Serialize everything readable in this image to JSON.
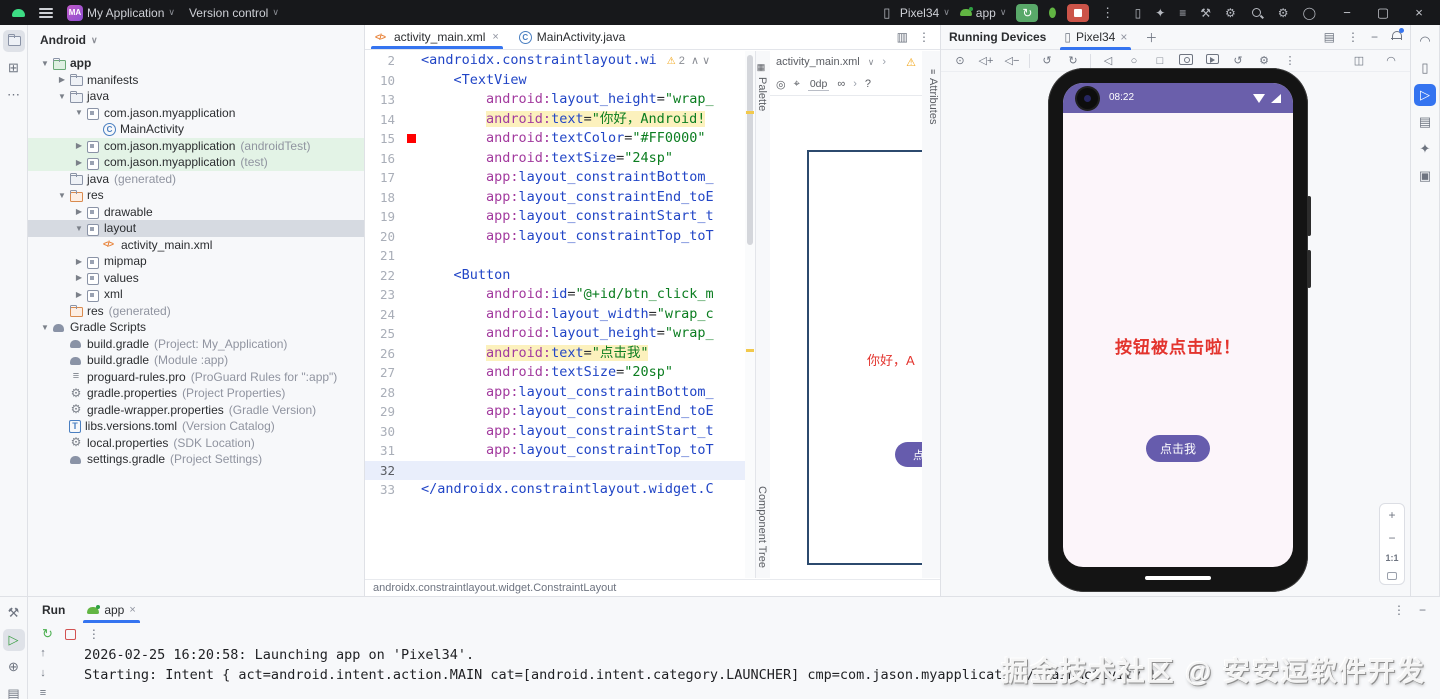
{
  "titlebar": {
    "project_badge": "MA",
    "project": "My Application",
    "version_control": "Version control",
    "device_selector": "Pixel34",
    "run_config": "app",
    "action_icons": [
      "device-manager",
      "ai-assistant",
      "commit",
      "build",
      "sdk-manager",
      "search",
      "settings",
      "account"
    ],
    "window_icons": [
      "minimize",
      "maximize",
      "close"
    ]
  },
  "left_strip": {
    "top": [
      "project",
      "structure",
      "more"
    ],
    "bottom": [
      "build",
      "run",
      "profiler",
      "logcat"
    ]
  },
  "project_panel": {
    "view": "Android",
    "tree": [
      {
        "label": "app",
        "depth": 0,
        "icon": "app",
        "arrow": "v",
        "bold": true
      },
      {
        "label": "manifests",
        "depth": 1,
        "icon": "folder",
        "arrow": ">"
      },
      {
        "label": "java",
        "depth": 1,
        "icon": "folder",
        "arrow": "v"
      },
      {
        "label": "com.jason.myapplication",
        "depth": 2,
        "icon": "pkg",
        "arrow": "v"
      },
      {
        "label": "MainActivity",
        "depth": 3,
        "icon": "class"
      },
      {
        "label": "com.jason.myapplication",
        "detail": "(androidTest)",
        "depth": 2,
        "icon": "pkg",
        "arrow": ">",
        "highlight": "green"
      },
      {
        "label": "com.jason.myapplication",
        "detail": "(test)",
        "depth": 2,
        "icon": "pkg",
        "arrow": ">",
        "highlight": "green"
      },
      {
        "label": "java",
        "detail": "(generated)",
        "depth": 1,
        "icon": "folder"
      },
      {
        "label": "res",
        "depth": 1,
        "icon": "res",
        "arrow": "v"
      },
      {
        "label": "drawable",
        "depth": 2,
        "icon": "pkg",
        "arrow": ">"
      },
      {
        "label": "layout",
        "depth": 2,
        "icon": "pkg",
        "arrow": "v",
        "highlight": "selected"
      },
      {
        "label": "activity_main.xml",
        "depth": 3,
        "icon": "xml"
      },
      {
        "label": "mipmap",
        "depth": 2,
        "icon": "pkg",
        "arrow": ">"
      },
      {
        "label": "values",
        "depth": 2,
        "icon": "pkg",
        "arrow": ">"
      },
      {
        "label": "xml",
        "depth": 2,
        "icon": "pkg",
        "arrow": ">"
      },
      {
        "label": "res",
        "detail": "(generated)",
        "depth": 1,
        "icon": "res"
      },
      {
        "label": "Gradle Scripts",
        "depth": 0,
        "icon": "gradle",
        "arrow": "v"
      },
      {
        "label": "build.gradle",
        "detail": "(Project: My_Application)",
        "depth": 1,
        "icon": "gradle"
      },
      {
        "label": "build.gradle",
        "detail": "(Module :app)",
        "depth": 1,
        "icon": "gradle"
      },
      {
        "label": "proguard-rules.pro",
        "detail": "(ProGuard Rules for \":app\")",
        "depth": 1,
        "icon": "list"
      },
      {
        "label": "gradle.properties",
        "detail": "(Project Properties)",
        "depth": 1,
        "icon": "gear"
      },
      {
        "label": "gradle-wrapper.properties",
        "detail": "(Gradle Version)",
        "depth": 1,
        "icon": "gear"
      },
      {
        "label": "libs.versions.toml",
        "detail": "(Version Catalog)",
        "depth": 1,
        "icon": "toml"
      },
      {
        "label": "local.properties",
        "detail": "(SDK Location)",
        "depth": 1,
        "icon": "gear"
      },
      {
        "label": "settings.gradle",
        "detail": "(Project Settings)",
        "depth": 1,
        "icon": "gradle"
      }
    ]
  },
  "editor": {
    "tabs": [
      {
        "label": "activity_main.xml",
        "icon": "xml",
        "active": true,
        "closable": true
      },
      {
        "label": "MainActivity.java",
        "icon": "class",
        "active": false
      }
    ],
    "warning_badge": "2",
    "breadcrumb": "androidx.constraintlayout.widget.ConstraintLayout",
    "lines": [
      {
        "n": "2",
        "ind": 0,
        "seg": [
          [
            "tag",
            "<androidx.constraintlayout.wi"
          ]
        ],
        "warn": true
      },
      {
        "n": "10",
        "ind": 1,
        "seg": [
          [
            "tag",
            "<TextView"
          ]
        ]
      },
      {
        "n": "13",
        "ind": 2,
        "seg": [
          [
            "ns",
            "android:"
          ],
          [
            "attr",
            "layout_height"
          ],
          [
            "pl",
            "="
          ],
          [
            "val",
            "\"wrap_"
          ]
        ]
      },
      {
        "n": "14",
        "ind": 2,
        "hl": true,
        "seg": [
          [
            "ns",
            "android:"
          ],
          [
            "attr",
            "text"
          ],
          [
            "pl",
            "="
          ],
          [
            "val",
            "\"你好，Android!"
          ]
        ]
      },
      {
        "n": "15",
        "ind": 2,
        "swatch": true,
        "seg": [
          [
            "ns",
            "android:"
          ],
          [
            "attr",
            "textColor"
          ],
          [
            "pl",
            "="
          ],
          [
            "val",
            "\"#FF0000\""
          ]
        ]
      },
      {
        "n": "16",
        "ind": 2,
        "seg": [
          [
            "ns",
            "android:"
          ],
          [
            "attr",
            "textSize"
          ],
          [
            "pl",
            "="
          ],
          [
            "val",
            "\"24sp\""
          ]
        ]
      },
      {
        "n": "17",
        "ind": 2,
        "seg": [
          [
            "ns",
            "app:"
          ],
          [
            "attr",
            "layout_constraintBottom_"
          ]
        ]
      },
      {
        "n": "18",
        "ind": 2,
        "seg": [
          [
            "ns",
            "app:"
          ],
          [
            "attr",
            "layout_constraintEnd_toE"
          ]
        ]
      },
      {
        "n": "19",
        "ind": 2,
        "seg": [
          [
            "ns",
            "app:"
          ],
          [
            "attr",
            "layout_constraintStart_t"
          ]
        ]
      },
      {
        "n": "20",
        "ind": 2,
        "seg": [
          [
            "ns",
            "app:"
          ],
          [
            "attr",
            "layout_constraintTop_toT"
          ]
        ]
      },
      {
        "n": "21",
        "ind": 0,
        "seg": []
      },
      {
        "n": "22",
        "ind": 1,
        "seg": [
          [
            "tag",
            "<Button"
          ]
        ]
      },
      {
        "n": "23",
        "ind": 2,
        "seg": [
          [
            "ns",
            "android:"
          ],
          [
            "attr",
            "id"
          ],
          [
            "pl",
            "="
          ],
          [
            "val",
            "\"@+id/btn_click_m"
          ]
        ]
      },
      {
        "n": "24",
        "ind": 2,
        "seg": [
          [
            "ns",
            "android:"
          ],
          [
            "attr",
            "layout_width"
          ],
          [
            "pl",
            "="
          ],
          [
            "val",
            "\"wrap_c"
          ]
        ]
      },
      {
        "n": "25",
        "ind": 2,
        "seg": [
          [
            "ns",
            "android:"
          ],
          [
            "attr",
            "layout_height"
          ],
          [
            "pl",
            "="
          ],
          [
            "val",
            "\"wrap_"
          ]
        ]
      },
      {
        "n": "26",
        "ind": 2,
        "hl": true,
        "seg": [
          [
            "ns",
            "android:"
          ],
          [
            "attr",
            "text"
          ],
          [
            "pl",
            "="
          ],
          [
            "val",
            "\"点击我\""
          ]
        ]
      },
      {
        "n": "27",
        "ind": 2,
        "seg": [
          [
            "ns",
            "android:"
          ],
          [
            "attr",
            "textSize"
          ],
          [
            "pl",
            "="
          ],
          [
            "val",
            "\"20sp\""
          ]
        ]
      },
      {
        "n": "28",
        "ind": 2,
        "seg": [
          [
            "ns",
            "app:"
          ],
          [
            "attr",
            "layout_constraintBottom_"
          ]
        ]
      },
      {
        "n": "29",
        "ind": 2,
        "seg": [
          [
            "ns",
            "app:"
          ],
          [
            "attr",
            "layout_constraintEnd_toE"
          ]
        ]
      },
      {
        "n": "30",
        "ind": 2,
        "seg": [
          [
            "ns",
            "app:"
          ],
          [
            "attr",
            "layout_constraintStart_t"
          ]
        ]
      },
      {
        "n": "31",
        "ind": 2,
        "seg": [
          [
            "ns",
            "app:"
          ],
          [
            "attr",
            "layout_constraintTop_toT"
          ]
        ]
      },
      {
        "n": "32",
        "ind": 0,
        "caret": true,
        "seg": []
      },
      {
        "n": "33",
        "ind": 0,
        "seg": [
          [
            "tag",
            "</androidx.constraintlayout.widget.C"
          ]
        ]
      }
    ]
  },
  "designer": {
    "palette_label": "Palette",
    "component_tree_label": "Component Tree",
    "attributes_label": "Attributes",
    "file": "activity_main.xml",
    "margin": "0dp",
    "help": "?",
    "preview": {
      "text": "你好，A",
      "button": "点击"
    }
  },
  "devices": {
    "title": "Running Devices",
    "tab": "Pixel34",
    "toolbar": [
      "power",
      "volume-up",
      "volume-down",
      "rotate-left",
      "rotate-right",
      "back",
      "home",
      "overview",
      "screenshot",
      "record",
      "restart",
      "device-settings",
      "more"
    ],
    "toolbar_right": [
      "display-mode",
      "extended-controls"
    ],
    "right_strip": [
      "gradle",
      "device-manager",
      "running-devices",
      "logcat",
      "gemini",
      "app-insights"
    ],
    "zoom": {
      "zoom_in": "+",
      "zoom_out": "−",
      "actual_size": "1:1"
    },
    "phone": {
      "time": "08:22",
      "message": "按钮被点击啦！",
      "button_label": "点击我"
    }
  },
  "run_panel": {
    "title": "Run",
    "tab": "app",
    "logs": [
      "2026-02-25 16:20:58: Launching app on 'Pixel34'.",
      "Starting: Intent { act=android.intent.action.MAIN cat=[android.intent.category.LAUNCHER] cmp=com.jason.myapplication/.MainActivity }"
    ]
  },
  "watermark": "掘金技术社区 @ 安安逗软件开发",
  "colors": {
    "accent": "#3574f0",
    "run_green": "#59a869",
    "stop_red": "#cc5449",
    "warning": "#f2a413",
    "code_tag": "#2145c6",
    "code_namespace": "#a23a9e",
    "code_value": "#0b7d20",
    "phone_status_bar": "#6a5fab",
    "phone_button": "#665cad",
    "message_red": "#e3342e",
    "text_color_value": "#FF0000"
  }
}
